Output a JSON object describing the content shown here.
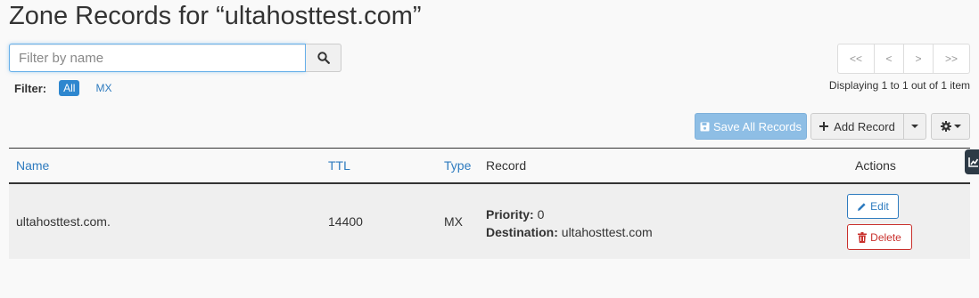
{
  "page": {
    "title": "Zone Records for “ultahosttest.com”"
  },
  "search": {
    "placeholder": "Filter by name",
    "value": ""
  },
  "filter": {
    "label": "Filter:",
    "options": [
      {
        "label": "All",
        "active": true
      },
      {
        "label": "MX",
        "active": false
      }
    ]
  },
  "pagination": {
    "first": "<<",
    "prev": "<",
    "next": ">",
    "last": ">>",
    "status": "Displaying 1 to 1 out of 1 item"
  },
  "toolbar": {
    "save_label": "Save All Records",
    "add_label": "Add Record"
  },
  "table": {
    "headers": {
      "name": "Name",
      "ttl": "TTL",
      "type": "Type",
      "record": "Record",
      "actions": "Actions"
    },
    "rows": [
      {
        "name": "ultahosttest.com.",
        "ttl": "14400",
        "type": "MX",
        "priority_label": "Priority:",
        "priority_value": "0",
        "destination_label": "Destination:",
        "destination_value": "ultahosttest.com",
        "edit_label": "Edit",
        "delete_label": "Delete"
      }
    ]
  },
  "colors": {
    "accent": "#2e87cf",
    "link": "#2e7bbf",
    "danger": "#c9302c",
    "save_disabled": "#8ebee5"
  }
}
